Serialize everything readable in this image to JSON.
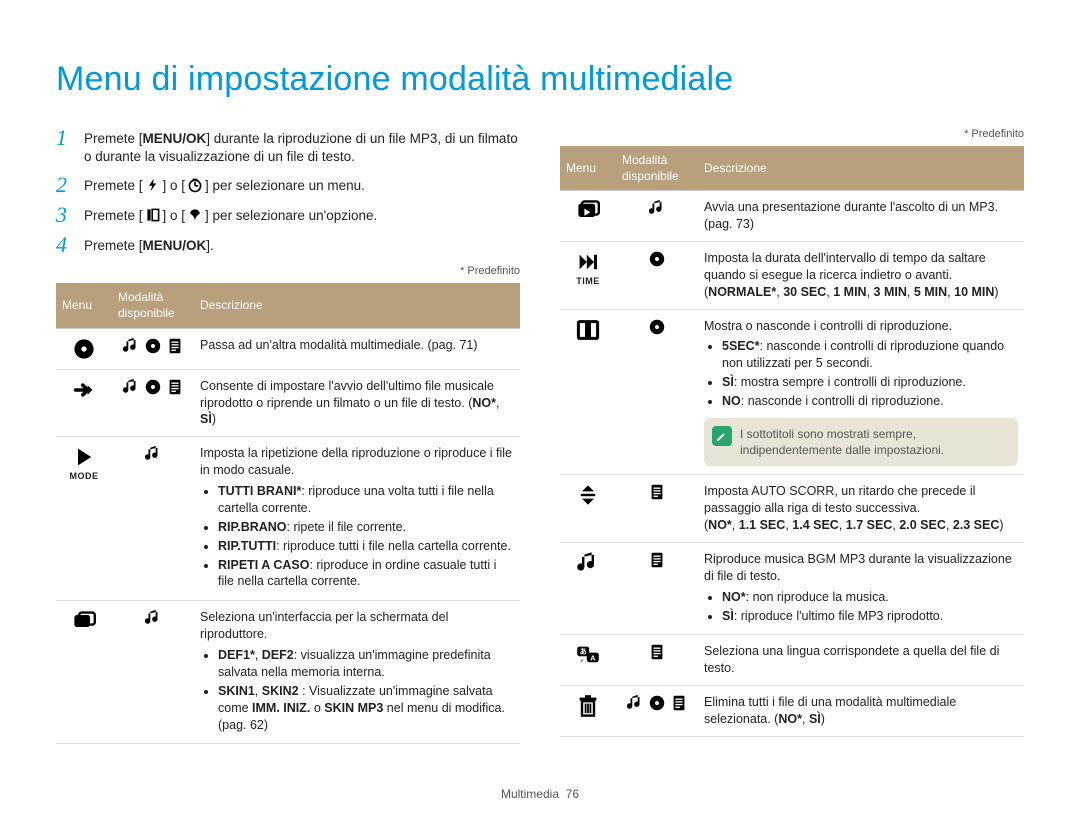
{
  "title": "Menu di impostazione modalità multimediale",
  "steps": [
    {
      "n": "1",
      "pre": "Premete [",
      "bold": "MENU/OK",
      "post": "] durante la riproduzione di un file MP3, di un filmato o durante la visualizzazione di un file di testo."
    },
    {
      "n": "2",
      "pre": "Premete [",
      "icon1": "flash",
      "mid": "] o [",
      "icon2": "timer",
      "post": "] per selezionare un menu."
    },
    {
      "n": "3",
      "pre": "Premete [",
      "icon1": "macro-left",
      "mid": "] o [",
      "icon2": "macro",
      "post": "] per selezionare un'opzione."
    },
    {
      "n": "4",
      "pre": "Premete [",
      "bold": "MENU/OK",
      "post": "]."
    }
  ],
  "predef": "* Predefinito",
  "headers": {
    "menu": "Menu",
    "mode": "Modalità disponibile",
    "desc": "Descrizione"
  },
  "left_rows": [
    {
      "menu": "disc",
      "menu_sub": null,
      "modes": [
        "music",
        "disc",
        "text"
      ],
      "desc_html": "Passa ad un'altra modalità multimediale. (pag. 71)"
    },
    {
      "menu": "arrow-right",
      "menu_sub": null,
      "modes": [
        "music",
        "disc",
        "text"
      ],
      "desc_html": "Consente di impostare l'avvio dell'ultimo file musicale riprodotto o riprende un filmato o un file di testo. (<b>NO*</b>, <b>SÌ</b>)"
    },
    {
      "menu": "play",
      "menu_sub": "MODE",
      "modes": [
        "music"
      ],
      "desc_html": "Imposta la ripetizione della riproduzione o riproduce i file in modo casuale.<ul class=\"b\"><li><b>TUTTI BRANI*</b>: riproduce una volta tutti i file nella cartella corrente.</li><li><b>RIP.BRANO</b>: ripete il file corrente.</li><li><b>RIP.TUTTI</b>: riproduce tutti i file nella cartella corrente.</li><li><b>RIPETI A CASO</b>: riproduce in ordine casuale tutti i file nella cartella corrente.</li></ul>"
    },
    {
      "menu": "skin",
      "menu_sub": null,
      "modes": [
        "music"
      ],
      "desc_html": "Seleziona un'interfaccia per la schermata del riproduttore.<ul class=\"b\"><li><b>DEF1*</b>, <b>DEF2</b>: visualizza un'immagine predefinita salvata nella memoria interna.</li><li><b>SKIN1</b>, <b>SKIN2</b> : Visualizzate un'immagine salvata come <b>IMM. INIZ.</b> o <b>SKIN MP3</b> nel menu di modifica. (pag. 62)</li></ul>"
    }
  ],
  "right_rows": [
    {
      "menu": "slideshow",
      "menu_sub": null,
      "modes": [
        "music"
      ],
      "desc_html": "Avvia una presentazione durante l'ascolto di un MP3. (pag. 73)"
    },
    {
      "menu": "skip",
      "menu_sub": "TIME",
      "modes": [
        "disc"
      ],
      "desc_html": "Imposta la durata dell'intervallo di tempo da saltare quando si esegue la ricerca indietro o avanti.<br>(<b>NORMALE*</b>, <b>30 SEC</b>, <b>1 MIN</b>, <b>3 MIN</b>, <b>5 MIN</b>, <b>10 MIN</b>)"
    },
    {
      "menu": "display",
      "menu_sub": null,
      "modes": [
        "disc"
      ],
      "desc_html": "Mostra o nasconde i controlli di riproduzione.<ul class=\"b\"><li><b>5SEC*</b>: nasconde i controlli di riproduzione quando non utilizzati per 5 secondi.</li><li><b>SÌ</b>: mostra sempre i controlli di riproduzione.</li><li><b>NO</b>: nasconde i controlli di riproduzione.</li></ul>",
      "note": "I sottotitoli sono mostrati sempre, indipendentemente dalle impostazioni."
    },
    {
      "menu": "scroll",
      "menu_sub": null,
      "modes": [
        "text"
      ],
      "desc_html": "Imposta AUTO SCORR, un ritardo che precede il passaggio alla riga di testo successiva.<br>(<b>NO*</b>, <b>1.1 SEC</b>, <b>1.4 SEC</b>, <b>1.7 SEC</b>, <b>2.0 SEC</b>, <b>2.3 SEC</b>)"
    },
    {
      "menu": "music",
      "menu_sub": null,
      "modes": [
        "text"
      ],
      "desc_html": "Riproduce musica BGM MP3 durante la visualizzazione di file di testo.<ul class=\"b\"><li><b>NO*</b>: non riproduce la musica.</li><li><b>SÌ</b>: riproduce l'ultimo file MP3 riprodotto.</li></ul>"
    },
    {
      "menu": "lang",
      "menu_sub": null,
      "modes": [
        "text"
      ],
      "desc_html": "Seleziona una lingua corrispondete a quella del file di testo."
    },
    {
      "menu": "trash",
      "menu_sub": null,
      "modes": [
        "music",
        "disc",
        "text"
      ],
      "desc_html": "Elimina tutti i file di una modalità multimediale selezionata. (<b>NO*</b>, <b>SÌ</b>)"
    }
  ],
  "footer": {
    "section": "Multimedia",
    "page": "76"
  }
}
